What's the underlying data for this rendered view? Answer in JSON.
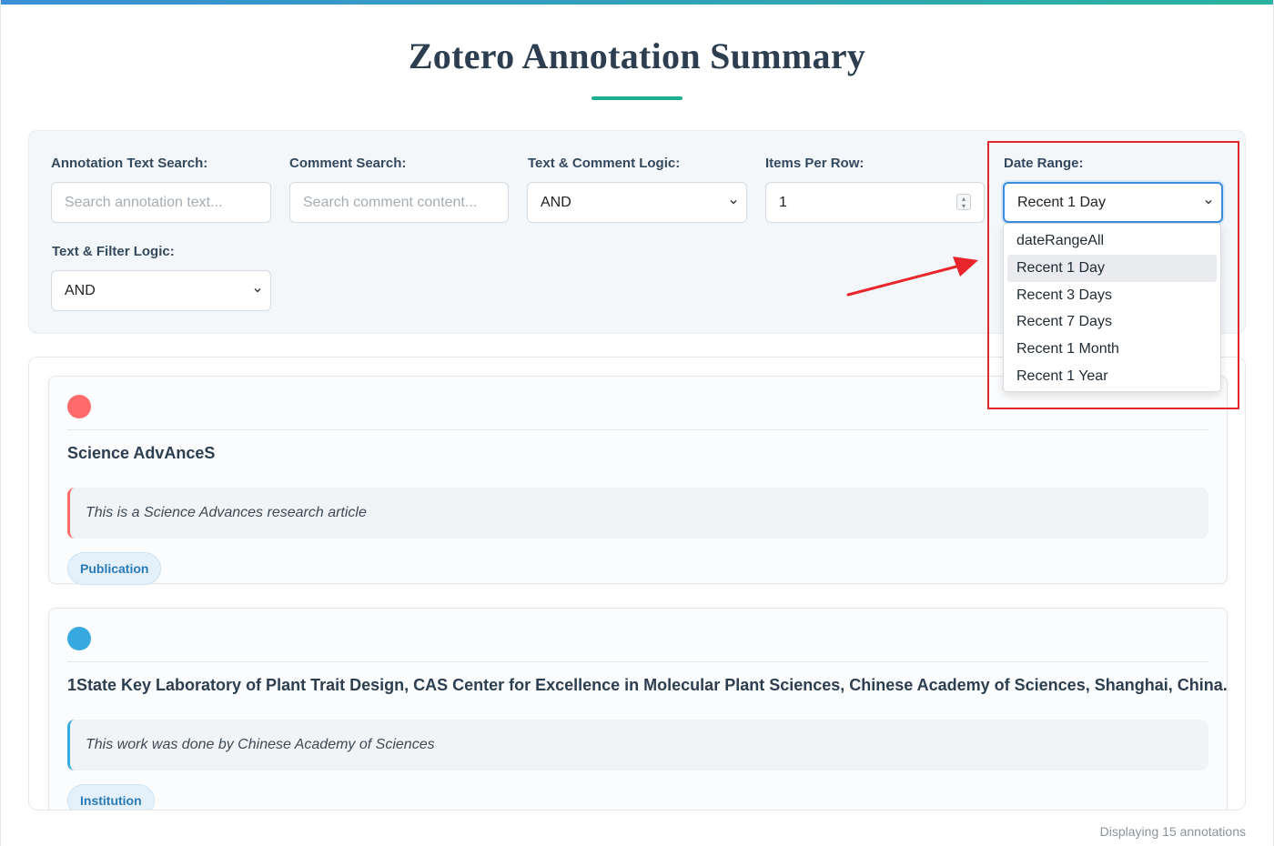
{
  "header": {
    "title": "Zotero Annotation Summary"
  },
  "filters": {
    "annotation_search": {
      "label": "Annotation Text Search:",
      "placeholder": "Search annotation text..."
    },
    "comment_search": {
      "label": "Comment Search:",
      "placeholder": "Search comment content..."
    },
    "text_comment_logic": {
      "label": "Text & Comment Logic:",
      "value": "AND"
    },
    "items_per_row": {
      "label": "Items Per Row:",
      "value": "1"
    },
    "date_range": {
      "label": "Date Range:",
      "value": "Recent 1 Day",
      "options": [
        "dateRangeAll",
        "Recent 1 Day",
        "Recent 3 Days",
        "Recent 7 Days",
        "Recent 1 Month",
        "Recent 1 Year"
      ],
      "highlighted_option": "Recent 1 Day"
    },
    "text_filter_logic": {
      "label": "Text & Filter Logic:",
      "value": "AND"
    }
  },
  "annotations": [
    {
      "color": "#ff6b6b",
      "title": "Science AdvAnceS",
      "comment": "This is a Science Advances research article",
      "tag": "Publication"
    },
    {
      "color": "#36a9e1",
      "title": "1State Key Laboratory of Plant Trait Design, CAS Center for Excellence in Molecular Plant Sciences, Chinese Academy of Sciences, Shanghai, China.",
      "comment": "This work was done by Chinese Academy of Sciences",
      "tag": "Institution"
    }
  ],
  "footer": {
    "count_text": "Displaying 15 annotations"
  },
  "colors": {
    "accent": "#1fae94",
    "focus": "#3b8de0",
    "callout": "#e0282e"
  }
}
